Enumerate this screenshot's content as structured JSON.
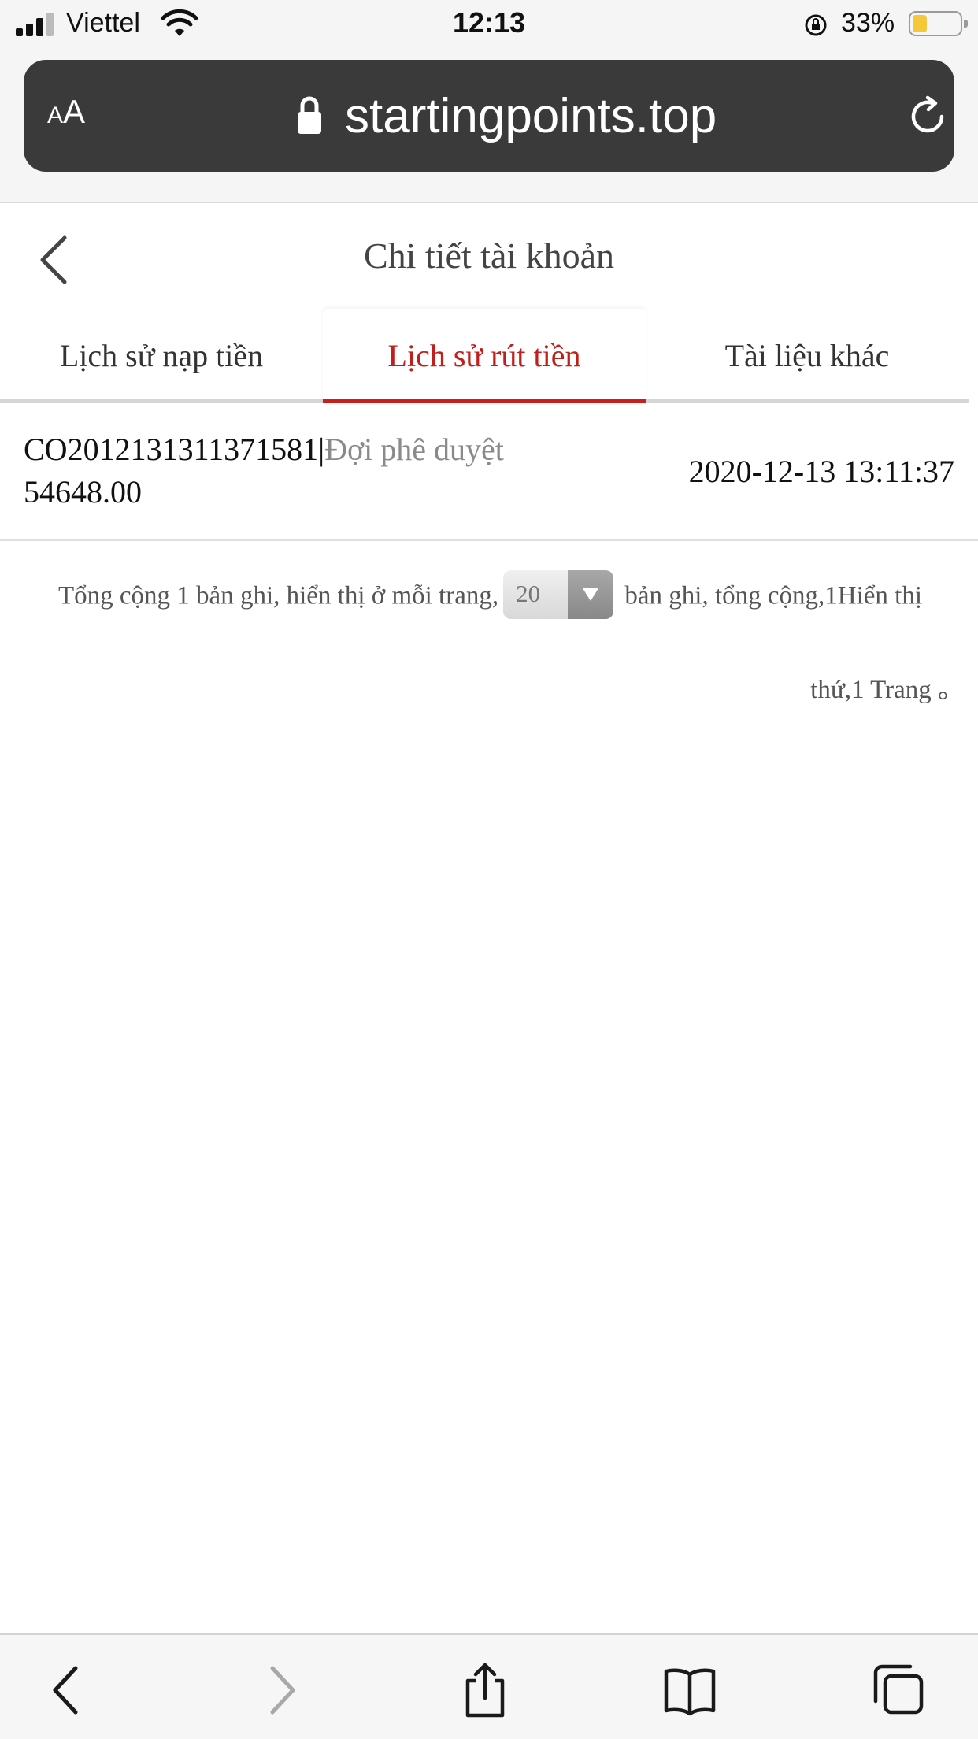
{
  "status_bar": {
    "carrier": "Viettel",
    "time": "12:13",
    "battery_percent": "33%",
    "battery_level": 0.33,
    "icons": [
      "signal-icon",
      "wifi-icon",
      "orientation-lock-icon",
      "battery-icon"
    ]
  },
  "browser": {
    "text_size_label": {
      "small": "A",
      "big": "A"
    },
    "url": "startingpoints.top",
    "icons": [
      "lock-icon",
      "reload-icon"
    ]
  },
  "header": {
    "title": "Chi tiết tài khoản",
    "icons": [
      "back-chevron-icon"
    ]
  },
  "tabs": [
    {
      "label": "Lịch sử nạp tiền",
      "active": false
    },
    {
      "label": "Lịch sử rút tiền",
      "active": true
    },
    {
      "label": "Tài liệu khác",
      "active": false
    }
  ],
  "records": [
    {
      "id": "CO2012131311371581",
      "separator": "|",
      "status": "Đợi phê duyệt",
      "amount": "54648.00",
      "time": "2020-12-13 13:11:37"
    }
  ],
  "pagination": {
    "text_before": "Tổng cộng 1 bản ghi, hiển thị ở mỗi trang,",
    "page_size": "20",
    "text_after": "bản ghi, tổng cộng,1Hiển thị",
    "line2": "thứ,1 Trang 。"
  },
  "toolbar": {
    "icons": [
      "back-arrow-icon",
      "forward-arrow-icon",
      "share-icon",
      "bookmarks-icon",
      "tabs-icon"
    ]
  },
  "colors": {
    "accent": "#c81e1e",
    "status_text": "#8a8a8a",
    "url_bar": "#3a3a3a"
  }
}
